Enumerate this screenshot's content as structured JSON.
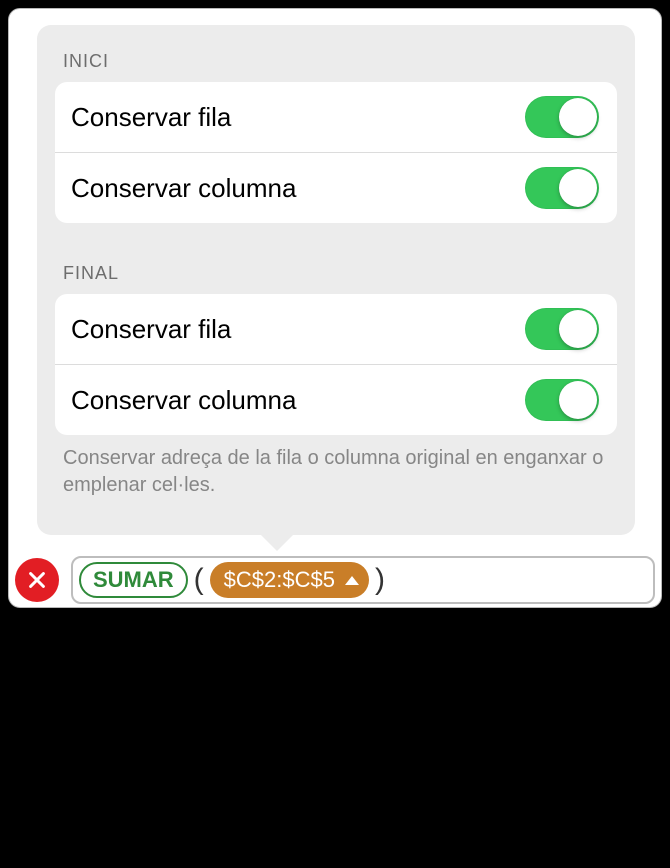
{
  "sections": {
    "start": {
      "title": "INICI",
      "rows": {
        "keep_row": {
          "label": "Conservar fila",
          "on": true
        },
        "keep_col": {
          "label": "Conservar columna",
          "on": true
        }
      }
    },
    "end": {
      "title": "FINAL",
      "rows": {
        "keep_row": {
          "label": "Conservar fila",
          "on": true
        },
        "keep_col": {
          "label": "Conservar columna",
          "on": true
        }
      }
    }
  },
  "footnote": "Conservar adreça de la fila o columna original en enganxar o emplenar cel·les.",
  "formula": {
    "function": "SUMAR",
    "open_paren": "(",
    "close_paren": ")",
    "reference": "$C$2:$C$5"
  },
  "colors": {
    "toggle_on": "#34c759",
    "close_btn": "#e21e24",
    "ref_pill": "#c97e28",
    "func_border": "#2f8a3a"
  }
}
